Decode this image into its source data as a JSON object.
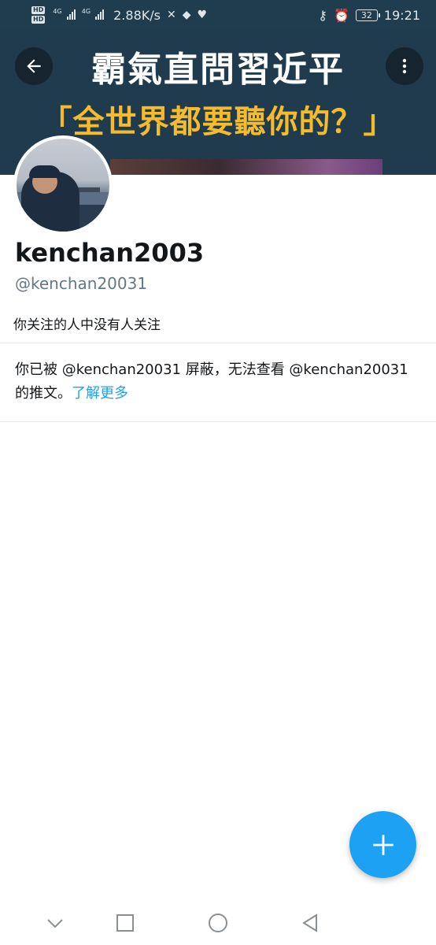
{
  "status_bar": {
    "hd1": "HD",
    "hd2": "HD",
    "net1": "4G",
    "net2": "4G",
    "speed": "2.88K/s",
    "battery": "32",
    "time": "19:21"
  },
  "banner": {
    "title": "霸氣直問習近平",
    "subtitle": "「全世界都要聽你的？」"
  },
  "profile": {
    "display_name": "kenchan2003",
    "handle": "@kenchan20031",
    "follow_note": "你关注的人中没有人关注"
  },
  "blocked": {
    "message": "你已被 @kenchan20031 屏蔽，无法查看 @kenchan20031 的推文。",
    "learn_more": "了解更多"
  },
  "fab": {
    "symbol": "+"
  },
  "icons": {
    "back": "arrow-left-icon",
    "more": "more-vertical-icon",
    "fab": "plus-icon"
  },
  "colors": {
    "accent": "#1da1f2",
    "banner_bg": "#1f3b4d",
    "banner_subtitle": "#f4bb2c"
  }
}
